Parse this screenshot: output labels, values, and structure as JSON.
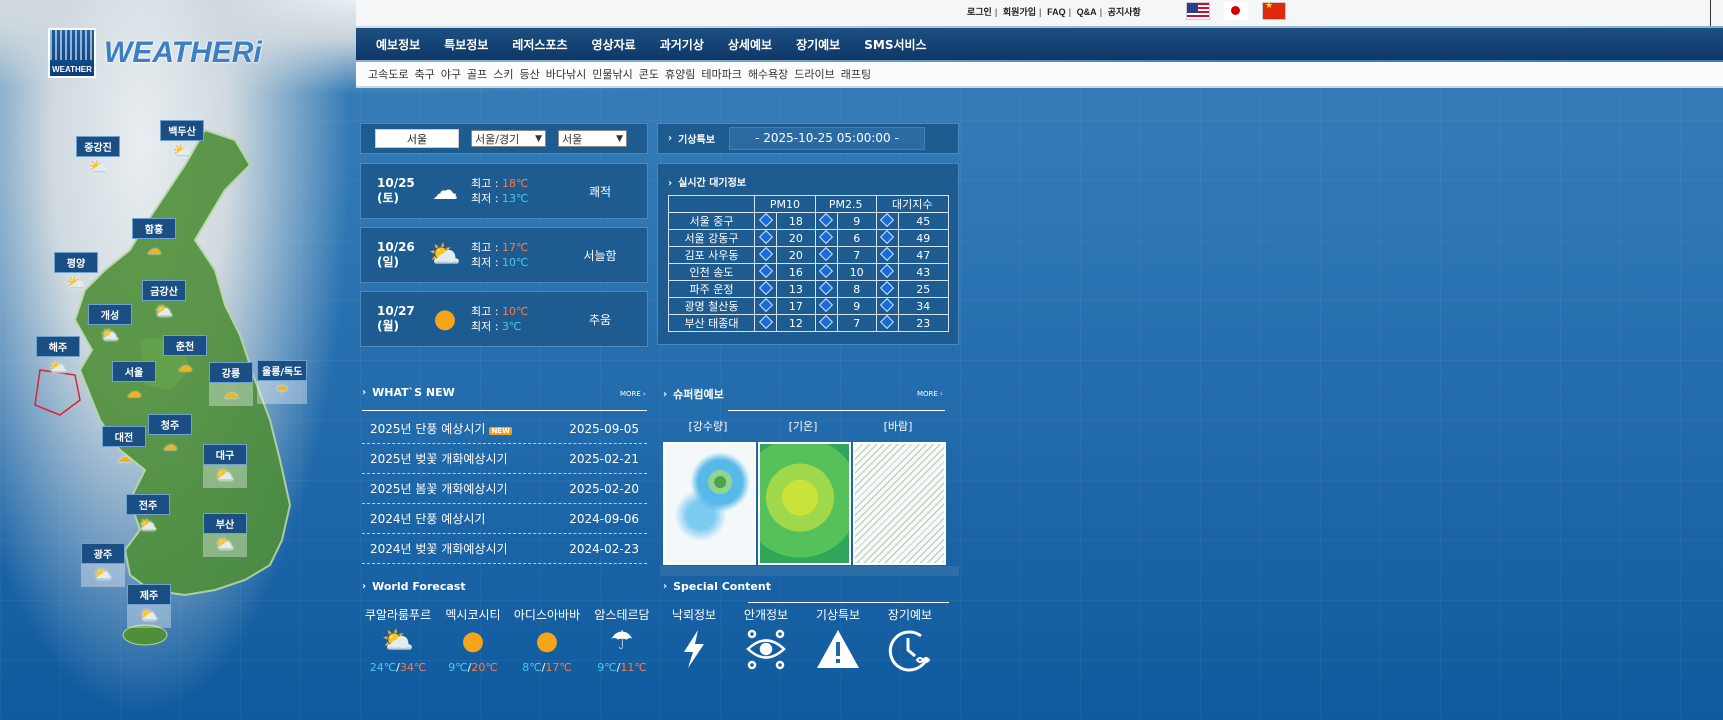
{
  "top_links": [
    "로그인",
    "회원가입",
    "FAQ",
    "Q&A",
    "공지사항"
  ],
  "flags": [
    "us-flag-icon",
    "japan-flag-icon",
    "china-flag-icon"
  ],
  "logo": {
    "box_text": "WEATHER",
    "text": "WEATHERi"
  },
  "main_nav": [
    "예보정보",
    "특보정보",
    "레저스포츠",
    "영상자료",
    "과거기상",
    "상세예보",
    "장기예보",
    "SMS서비스"
  ],
  "sub_nav": [
    "고속도로",
    "축구",
    "야구",
    "골프",
    "스키",
    "등산",
    "바다낚시",
    "민물낚시",
    "콘도",
    "휴양림",
    "테마파크",
    "해수욕장",
    "드라이브",
    "래프팅"
  ],
  "map_regions": [
    {
      "name": "백두산"
    },
    {
      "name": "중강진"
    },
    {
      "name": "함흥"
    },
    {
      "name": "평양"
    },
    {
      "name": "금강산"
    },
    {
      "name": "개성"
    },
    {
      "name": "해주"
    },
    {
      "name": "춘천"
    },
    {
      "name": "서울"
    },
    {
      "name": "강릉"
    },
    {
      "name": "울릉/독도"
    },
    {
      "name": "청주"
    },
    {
      "name": "대전"
    },
    {
      "name": "대구"
    },
    {
      "name": "전주"
    },
    {
      "name": "부산"
    },
    {
      "name": "광주"
    },
    {
      "name": "제주"
    }
  ],
  "location": {
    "city_button": "서울",
    "region_select": "서울/경기",
    "city_select": "서울"
  },
  "forecast": [
    {
      "date": "10/25",
      "weekday": "(토)",
      "high_label": "최고 : ",
      "high": "18℃",
      "low_label": "최저 : ",
      "low": "13℃",
      "desc": "쾌적",
      "icon": "cloud-icon"
    },
    {
      "date": "10/26",
      "weekday": "(일)",
      "high_label": "최고 : ",
      "high": "17℃",
      "low_label": "최저 : ",
      "low": "10℃",
      "desc": "서늘함",
      "icon": "partly-cloudy-icon"
    },
    {
      "date": "10/27",
      "weekday": "(월)",
      "high_label": "최고 : ",
      "high": "10℃",
      "low_label": "최저 : ",
      "low": "3℃",
      "desc": "추움",
      "icon": "sun-icon"
    }
  ],
  "alert": {
    "label": "기상특보",
    "time": "- 2025-10-25 05:00:00 -"
  },
  "air": {
    "title": "실시간 대기정보",
    "headers": [
      "PM10",
      "PM2.5",
      "대기지수"
    ],
    "rows": [
      {
        "station": "서울 중구",
        "pm10": "18",
        "pm25": "9",
        "index": "45"
      },
      {
        "station": "서울 강동구",
        "pm10": "20",
        "pm25": "6",
        "index": "49"
      },
      {
        "station": "김포 사우동",
        "pm10": "20",
        "pm25": "7",
        "index": "47"
      },
      {
        "station": "인천 송도",
        "pm10": "16",
        "pm25": "10",
        "index": "43"
      },
      {
        "station": "파주 운정",
        "pm10": "13",
        "pm25": "8",
        "index": "25"
      },
      {
        "station": "광명 철산동",
        "pm10": "17",
        "pm25": "9",
        "index": "34"
      },
      {
        "station": "부산 태종대",
        "pm10": "12",
        "pm25": "7",
        "index": "23"
      }
    ]
  },
  "whats_new": {
    "title": "WHAT`S NEW",
    "more": "MORE ›",
    "new_badge": "NEW",
    "items": [
      {
        "title": "2025년 단풍 예상시기",
        "date": "2025-09-05"
      },
      {
        "title": "2025년 벚꽃 개화예상시기",
        "date": "2025-02-21"
      },
      {
        "title": "2025년 봄꽃 개화예상시기",
        "date": "2025-02-20"
      },
      {
        "title": "2024년 단풍 예상시기",
        "date": "2024-09-06"
      },
      {
        "title": "2024년 벚꽃 개화예상시기",
        "date": "2024-02-23"
      }
    ]
  },
  "supercomputer": {
    "title": "슈퍼컴예보",
    "more": "MORE ›",
    "labels": [
      "[강수량]",
      "[기온]",
      "[바람]"
    ]
  },
  "world_forecast": {
    "title": "World Forecast",
    "cities": [
      {
        "name": "쿠알라룸푸르",
        "low": "24℃",
        "sep": "/",
        "high": "34℃",
        "icon": "partly-cloudy-icon"
      },
      {
        "name": "멕시코시티",
        "low": "9℃",
        "sep": "/",
        "high": "20℃",
        "icon": "sun-icon"
      },
      {
        "name": "아디스아바바",
        "low": "8℃",
        "sep": "/",
        "high": "17℃",
        "icon": "sun-icon"
      },
      {
        "name": "암스테르담",
        "low": "9℃",
        "sep": "/",
        "high": "11℃",
        "icon": "rain-cloud-icon"
      }
    ]
  },
  "special_content": {
    "title": "Special Content",
    "items": [
      "낙뢰정보",
      "안개정보",
      "기상특보",
      "장기예보"
    ]
  },
  "colors": {
    "nav_bg": "#0e3767",
    "panel_bg": "#1d5b91",
    "high_temp": "#ff7b3a",
    "low_temp": "#48c9e9"
  }
}
